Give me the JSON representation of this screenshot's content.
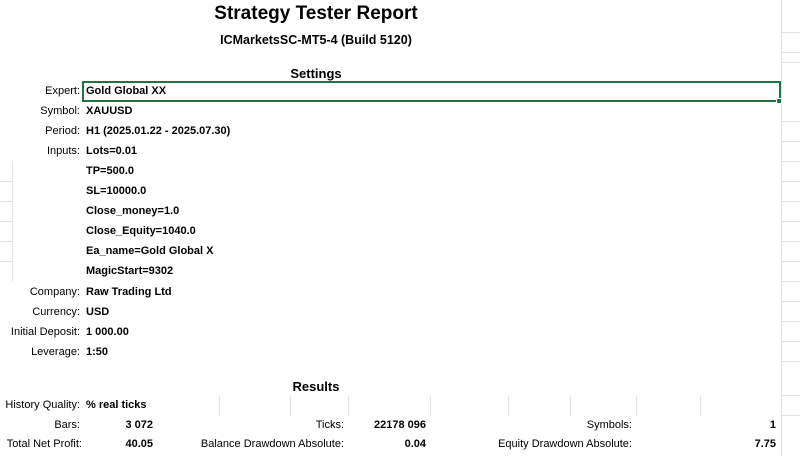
{
  "report": {
    "title": "Strategy Tester Report",
    "subtitle": "ICMarketsSC-MT5-4 (Build 5120)"
  },
  "settings": {
    "heading": "Settings",
    "expert_label": "Expert:",
    "expert_value": "Gold Global XX",
    "symbol_label": "Symbol:",
    "symbol_value": "XAUUSD",
    "period_label": "Period:",
    "period_value": "H1 (2025.01.22 - 2025.07.30)",
    "inputs_label": "Inputs:",
    "inputs": [
      "Lots=0.01",
      "TP=500.0",
      "SL=10000.0",
      "Close_money=1.0",
      "Close_Equity=1040.0",
      "Ea_name=Gold Global X",
      "MagicStart=9302"
    ],
    "company_label": "Company:",
    "company_value": "Raw Trading Ltd",
    "currency_label": "Currency:",
    "currency_value": "USD",
    "deposit_label": "Initial Deposit:",
    "deposit_value": "1 000.00",
    "leverage_label": "Leverage:",
    "leverage_value": "1:50"
  },
  "results": {
    "heading": "Results",
    "history_quality_label": "History Quality:",
    "history_quality_value": "% real ticks",
    "bars_label": "Bars:",
    "bars_value": "3 072",
    "ticks_label": "Ticks:",
    "ticks_value": "22178 096",
    "symbols_label": "Symbols:",
    "symbols_value": "1",
    "net_profit_label": "Total Net Profit:",
    "net_profit_value": "40.05",
    "balance_dd_label": "Balance Drawdown Absolute:",
    "balance_dd_value": "0.04",
    "equity_dd_label": "Equity Drawdown Absolute:",
    "equity_dd_value": "7.75"
  },
  "colors": {
    "selection": "#217346",
    "gridline": "#e3e3e3"
  }
}
